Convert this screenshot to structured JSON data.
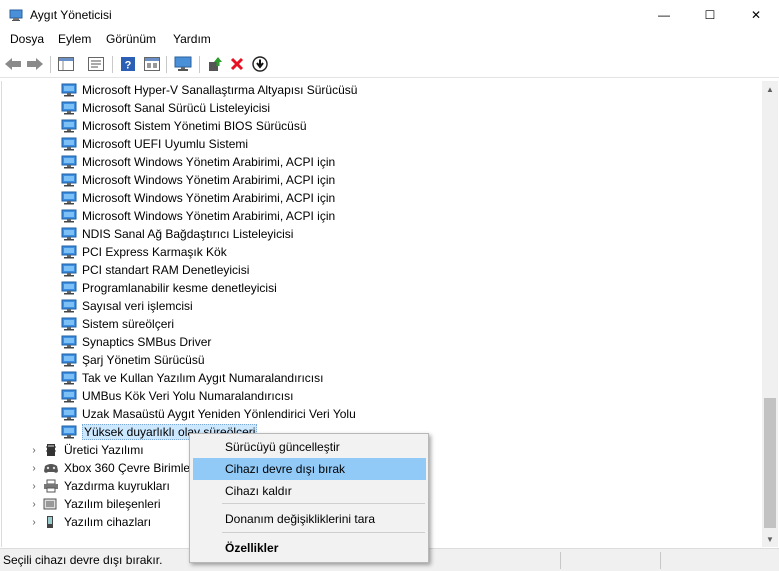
{
  "window": {
    "title": "Aygıt Yöneticisi",
    "minimize_glyph": "—",
    "maximize_glyph": "☐",
    "close_glyph": "✕"
  },
  "menu": [
    "Dosya",
    "Eylem",
    "Görünüm",
    "Yardım"
  ],
  "toolbar": {
    "icons": [
      "back-arrow-icon",
      "forward-arrow-icon",
      "show-hide-tree-icon",
      "properties-icon",
      "help-icon",
      "view-icon",
      "monitor-icon",
      "update-driver-icon",
      "uninstall-device-icon",
      "disable-device-icon"
    ]
  },
  "tree": {
    "system_devices": [
      "Microsoft Hyper-V Sanallaştırma Altyapısı Sürücüsü",
      "Microsoft Sanal Sürücü Listeleyicisi",
      "Microsoft Sistem Yönetimi BIOS Sürücüsü",
      "Microsoft UEFI Uyumlu Sistemi",
      "Microsoft Windows Yönetim Arabirimi, ACPI için",
      "Microsoft Windows Yönetim Arabirimi, ACPI için",
      "Microsoft Windows Yönetim Arabirimi, ACPI için",
      "Microsoft Windows Yönetim Arabirimi, ACPI için",
      "NDIS Sanal Ağ Bağdaştırıcı Listeleyicisi",
      "PCI Express Karmaşık Kök",
      "PCI standart RAM Denetleyicisi",
      "Programlanabilir kesme denetleyicisi",
      "Sayısal veri işlemcisi",
      "Sistem süreölçeri",
      "Synaptics SMBus Driver",
      "Şarj Yönetim Sürücüsü",
      "Tak ve Kullan Yazılım Aygıt Numaralandırıcısı",
      "UMBus Kök Veri Yolu Numaralandırıcısı",
      "Uzak Masaüstü Aygıt Yeniden Yönlendirici Veri Yolu"
    ],
    "selected_device": "Yüksek duyarlıklı olay süreölçeri",
    "categories": [
      "Üretici Yazılımı",
      "Xbox 360 Çevre Birimleri",
      "Yazdırma kuyrukları",
      "Yazılım bileşenleri",
      "Yazılım cihazları"
    ],
    "expander_glyph": "›"
  },
  "context_menu": {
    "items": [
      "Sürücüyü güncelleştir",
      "Cihazı devre dışı bırak",
      "Cihazı kaldır",
      "Donanım değişikliklerini tara",
      "Özellikler"
    ],
    "highlighted_index": 1,
    "highlight_color": "#91c9f7"
  },
  "status": {
    "text": "Seçili cihazı devre dışı bırakır."
  },
  "colors": {
    "selection": "#cce8ff",
    "disable_red": "#e81123",
    "update_green": "#2a9d2a"
  }
}
